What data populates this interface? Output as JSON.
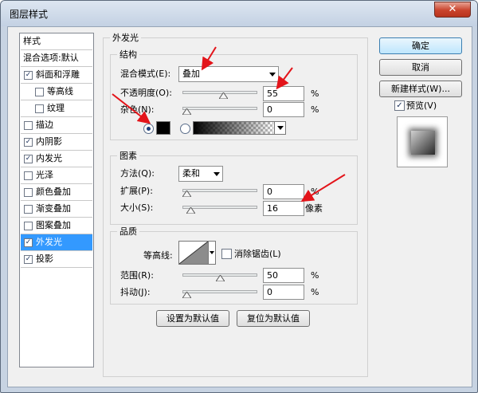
{
  "window": {
    "title": "图层样式",
    "close_glyph": "✕"
  },
  "style_list": [
    {
      "label": "样式",
      "checkbox": false,
      "checked": false,
      "indent": 0,
      "selected": false
    },
    {
      "label": "混合选项:默认",
      "checkbox": false,
      "checked": false,
      "indent": 0,
      "selected": false
    },
    {
      "label": "斜面和浮雕",
      "checkbox": true,
      "checked": true,
      "indent": 0,
      "selected": false
    },
    {
      "label": "等高线",
      "checkbox": true,
      "checked": false,
      "indent": 1,
      "selected": false
    },
    {
      "label": "纹理",
      "checkbox": true,
      "checked": false,
      "indent": 1,
      "selected": false
    },
    {
      "label": "描边",
      "checkbox": true,
      "checked": false,
      "indent": 0,
      "selected": false
    },
    {
      "label": "内阴影",
      "checkbox": true,
      "checked": true,
      "indent": 0,
      "selected": false
    },
    {
      "label": "内发光",
      "checkbox": true,
      "checked": true,
      "indent": 0,
      "selected": false
    },
    {
      "label": "光泽",
      "checkbox": true,
      "checked": false,
      "indent": 0,
      "selected": false
    },
    {
      "label": "颜色叠加",
      "checkbox": true,
      "checked": false,
      "indent": 0,
      "selected": false
    },
    {
      "label": "渐变叠加",
      "checkbox": true,
      "checked": false,
      "indent": 0,
      "selected": false
    },
    {
      "label": "图案叠加",
      "checkbox": true,
      "checked": false,
      "indent": 0,
      "selected": false
    },
    {
      "label": "外发光",
      "checkbox": true,
      "checked": true,
      "indent": 0,
      "selected": true
    },
    {
      "label": "投影",
      "checkbox": true,
      "checked": true,
      "indent": 0,
      "selected": false
    }
  ],
  "outer_glow": {
    "title": "外发光",
    "structure": {
      "title": "结构",
      "blend_mode_label": "混合模式(E):",
      "blend_mode_value": "叠加",
      "opacity_label": "不透明度(O):",
      "opacity_value": "55",
      "opacity_level": 55,
      "noise_label": "杂色(N):",
      "noise_value": "0",
      "noise_level": 0,
      "percent": "%",
      "color_mode": "solid",
      "swatch_color": "#000000"
    },
    "elements": {
      "title": "图素",
      "technique_label": "方法(Q):",
      "technique_value": "柔和",
      "spread_label": "扩展(P):",
      "spread_value": "0",
      "spread_level": 0,
      "size_label": "大小(S):",
      "size_value": "16",
      "size_level": 6,
      "percent": "%",
      "px_unit": "像素"
    },
    "quality": {
      "title": "品质",
      "contour_label": "等高线:",
      "antialias_label": "消除锯齿(L)",
      "antialias_checked": false,
      "range_label": "范围(R):",
      "range_value": "50",
      "range_level": 50,
      "jitter_label": "抖动(J):",
      "jitter_value": "0",
      "jitter_level": 0,
      "percent": "%"
    },
    "set_default_label": "设置为默认值",
    "reset_default_label": "复位为默认值"
  },
  "buttons": {
    "ok": "确定",
    "cancel": "取消",
    "new_style": "新建样式(W)...",
    "preview_label": "预览(V)",
    "preview_checked": true
  },
  "annotation_color": "#e3141a"
}
